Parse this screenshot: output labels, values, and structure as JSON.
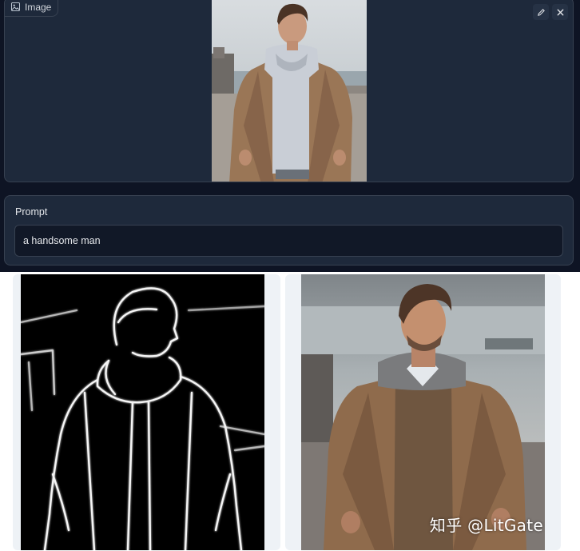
{
  "image_panel": {
    "label": "Image",
    "label_icon": "image-icon",
    "tools": [
      {
        "name": "edit",
        "icon": "pencil-icon"
      },
      {
        "name": "clear",
        "icon": "close-icon"
      }
    ]
  },
  "prompt_panel": {
    "label": "Prompt",
    "value": "a handsome man"
  },
  "watermark": "知乎 @LitGate",
  "colors": {
    "app_bg": "#0e1424",
    "panel_bg": "#1e293b",
    "border": "#374151",
    "text": "#e5e7eb"
  }
}
